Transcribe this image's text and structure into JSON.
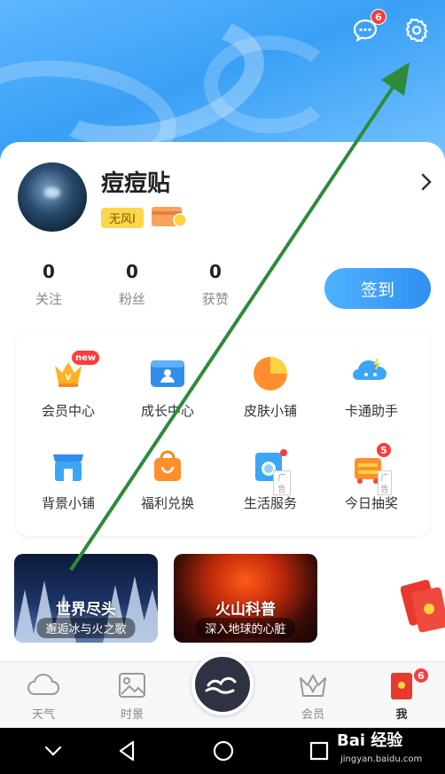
{
  "header": {
    "message_badge": "6"
  },
  "profile": {
    "username": "痘痘贴",
    "tag": "无风I"
  },
  "stats": [
    {
      "value": "0",
      "label": "关注"
    },
    {
      "value": "0",
      "label": "粉丝"
    },
    {
      "value": "0",
      "label": "获赞"
    }
  ],
  "signin_label": "签到",
  "grid": {
    "items": [
      {
        "label": "会员中心",
        "icon": "vip-crown-icon",
        "badge": "new"
      },
      {
        "label": "成长中心",
        "icon": "growth-id-icon"
      },
      {
        "label": "皮肤小铺",
        "icon": "skin-shop-icon"
      },
      {
        "label": "卡通助手",
        "icon": "cartoon-assistant-icon"
      },
      {
        "label": "背景小铺",
        "icon": "background-shop-icon"
      },
      {
        "label": "福利兑换",
        "icon": "welfare-bag-icon"
      },
      {
        "label": "生活服务",
        "icon": "life-service-icon",
        "ad": "广告"
      },
      {
        "label": "今日抽奖",
        "icon": "lottery-icon",
        "ad": "广告",
        "badge": "5"
      }
    ]
  },
  "banners": [
    {
      "title": "世界尽头",
      "subtitle": "邂逅冰与火之歌"
    },
    {
      "title": "火山科普",
      "subtitle": "深入地球的心脏"
    }
  ],
  "tabbar": {
    "items": [
      {
        "label": "天气"
      },
      {
        "label": "时景"
      },
      {
        "label": "会员"
      },
      {
        "label": "我",
        "badge": "6"
      }
    ]
  },
  "watermark": {
    "brand": "Bai 经验",
    "url": "jingyan.baidu.com"
  },
  "colors": {
    "accent": "#2f90f0",
    "badge": "#ff3b3b",
    "annotation_arrow": "#2e8b3a"
  }
}
